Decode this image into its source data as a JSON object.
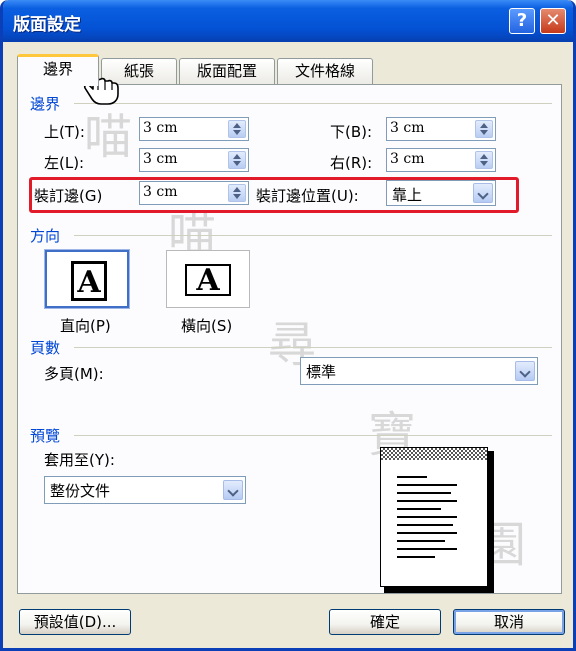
{
  "window": {
    "title": "版面設定",
    "help_glyph": "?",
    "close_glyph": "✕"
  },
  "tabs": [
    {
      "label": "邊界"
    },
    {
      "label": "紙張"
    },
    {
      "label": "版面配置"
    },
    {
      "label": "文件格線"
    }
  ],
  "margins": {
    "title": "邊界",
    "top_label": "上(T):",
    "top_value": "3 cm",
    "bottom_label": "下(B):",
    "bottom_value": "3 cm",
    "left_label": "左(L):",
    "left_value": "3 cm",
    "right_label": "右(R):",
    "right_value": "3 cm",
    "gutter_label": "裝訂邊(G)",
    "gutter_value": "3 cm",
    "gutter_pos_label": "裝訂邊位置(U):",
    "gutter_pos_value": "靠上"
  },
  "orientation": {
    "title": "方向",
    "portrait_label": "直向(P)",
    "landscape_label": "橫向(S)",
    "glyph": "A"
  },
  "pages": {
    "title": "頁數",
    "multiple_label": "多頁(M):",
    "multiple_value": "標準"
  },
  "preview": {
    "title": "預覽",
    "apply_label": "套用至(Y):",
    "apply_value": "整份文件"
  },
  "buttons": {
    "default": "預設值(D)...",
    "ok": "確定",
    "cancel": "取消"
  },
  "watermark": {
    "chars": [
      "喵",
      "喵",
      "尋",
      "寶",
      "園"
    ]
  },
  "colors": {
    "title_bar": "#0451d4",
    "section_title": "#0046d5",
    "highlight": "#e21b2b"
  }
}
